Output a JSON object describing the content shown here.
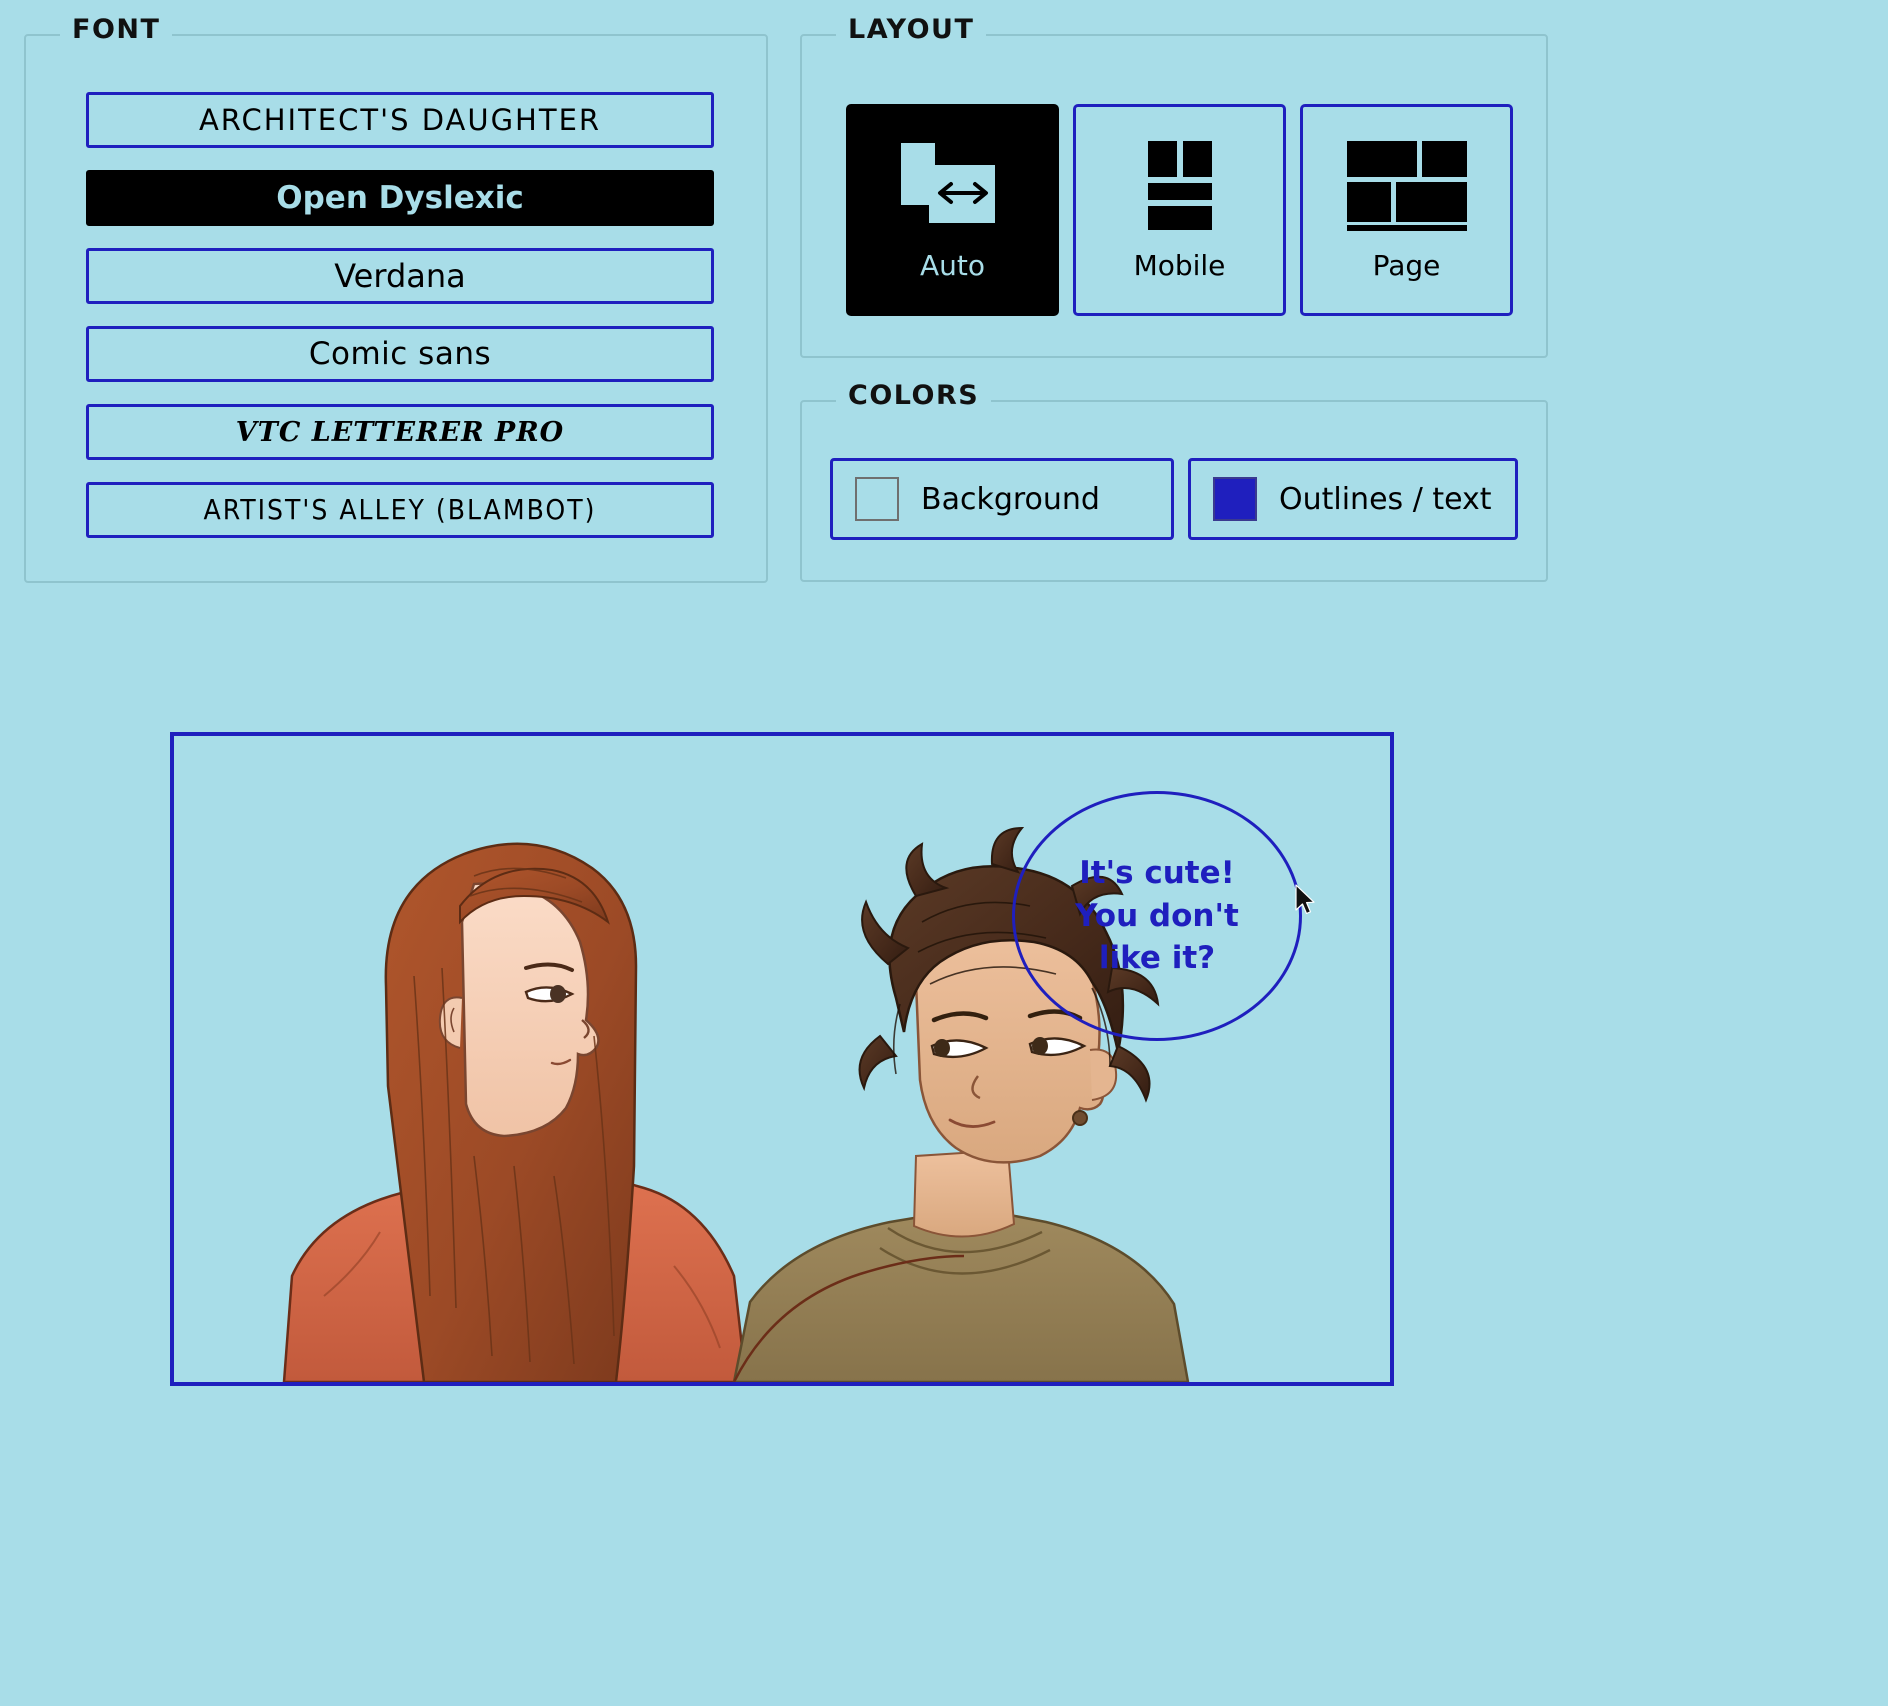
{
  "background_color": "#a8dde8",
  "outline_color": "#1f1fbe",
  "font_panel": {
    "title": "FONT",
    "options": [
      {
        "label": "ARCHITECT'S DAUGHTER",
        "selected": false
      },
      {
        "label": "Open Dyslexic",
        "selected": true
      },
      {
        "label": "Verdana",
        "selected": false
      },
      {
        "label": "Comic sans",
        "selected": false
      },
      {
        "label": "VTC LETTERER PRO",
        "selected": false
      },
      {
        "label": "ARTIST'S ALLEY (BLAMBOT)",
        "selected": false
      }
    ]
  },
  "layout_panel": {
    "title": "LAYOUT",
    "options": [
      {
        "label": "Auto",
        "icon": "auto-layout-icon",
        "selected": true
      },
      {
        "label": "Mobile",
        "icon": "mobile-layout-icon",
        "selected": false
      },
      {
        "label": "Page",
        "icon": "page-layout-icon",
        "selected": false
      }
    ]
  },
  "colors_panel": {
    "title": "COLORS",
    "swatches": [
      {
        "label": "Background",
        "color": "#a8dde8"
      },
      {
        "label": "Outlines / text",
        "color": "#1f1fbe"
      }
    ]
  },
  "comic_preview": {
    "speech_bubble": {
      "lines": [
        "It's cute!",
        "You don't",
        "like it?"
      ],
      "text_color": "#1f1fbe"
    },
    "cursor": "mouse-pointer-icon"
  }
}
